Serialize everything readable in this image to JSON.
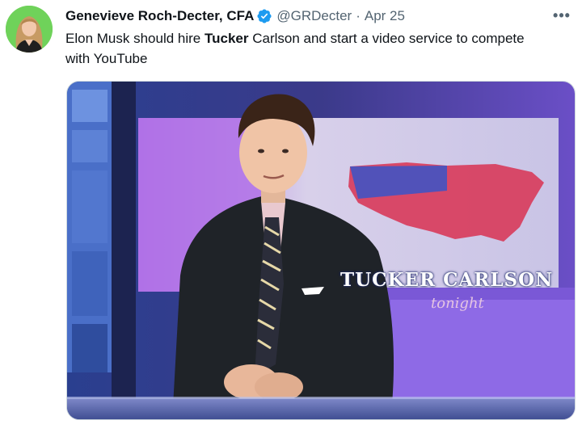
{
  "tweet": {
    "author_name": "Genevieve Roch-Decter, CFA",
    "author_handle": "@GRDecter",
    "separator": "·",
    "date": "Apr 25",
    "more_label": "•••",
    "text_before": "Elon Musk should hire ",
    "text_bold": "Tucker",
    "text_after": " Carlson and start a video service to compete with YouTube"
  },
  "media": {
    "screen_title": "TUCKER CARLSON",
    "screen_subtitle": "tonight"
  },
  "icons": {
    "verified": "verified-badge-icon",
    "more": "more-options-icon"
  },
  "colors": {
    "verified_blue": "#1d9bf0",
    "secondary_text": "#536471",
    "avatar_bg": "#6fd25a"
  }
}
